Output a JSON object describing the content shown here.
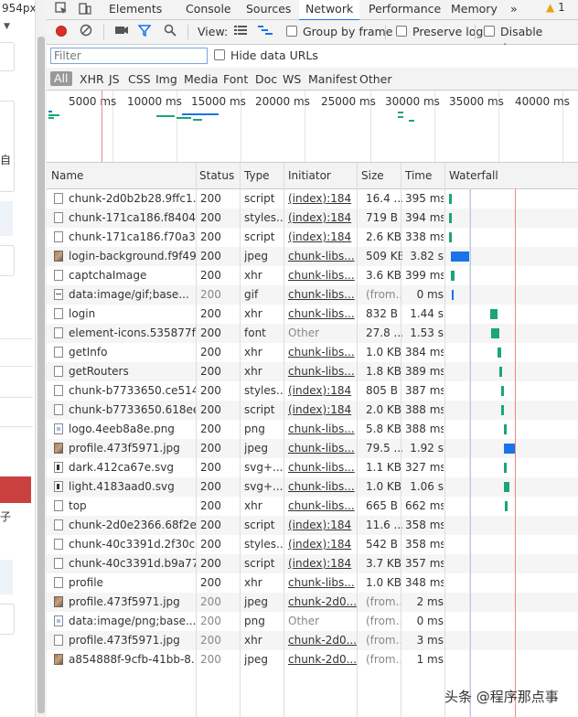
{
  "left": {
    "px_label": "954px",
    "zh_char": "自",
    "zh_char2": "子"
  },
  "tabs": {
    "items": [
      "Elements",
      "Console",
      "Sources",
      "Network",
      "Performance",
      "Memory"
    ],
    "more": "»",
    "warn_count": "1"
  },
  "toolbar": {
    "view_label": "View:",
    "group_by_frame": "Group by frame",
    "preserve_log": "Preserve log",
    "disable_cache": "Disable cache"
  },
  "filter": {
    "placeholder": "Filter",
    "hide_data_urls": "Hide data URLs"
  },
  "types": [
    "All",
    "XHR",
    "JS",
    "CSS",
    "Img",
    "Media",
    "Font",
    "Doc",
    "WS",
    "Manifest",
    "Other"
  ],
  "overview": {
    "labels": [
      "5000 ms",
      "10000 ms",
      "15000 ms",
      "20000 ms",
      "25000 ms",
      "30000 ms",
      "35000 ms",
      "40000 ms"
    ]
  },
  "columns": [
    "Name",
    "Status",
    "Type",
    "Initiator",
    "Size",
    "Time",
    "Waterfall"
  ],
  "rows": [
    {
      "name": "chunk-2d0b2b28.9ffc1...",
      "status": "200",
      "type": "script",
      "initiator": "(index):184",
      "size": "16.4 ...",
      "time": "395 ms",
      "icon": "doc"
    },
    {
      "name": "chunk-171ca186.f8404...",
      "status": "200",
      "type": "styles...",
      "initiator": "(index):184",
      "size": "719 B",
      "time": "394 ms",
      "icon": "doc"
    },
    {
      "name": "chunk-171ca186.f70a3f...",
      "status": "200",
      "type": "script",
      "initiator": "(index):184",
      "size": "2.6 KB",
      "time": "338 ms",
      "icon": "doc"
    },
    {
      "name": "login-background.f9f49...",
      "status": "200",
      "type": "jpeg",
      "initiator": "chunk-libs...",
      "size": "509 KB",
      "time": "3.82 s",
      "icon": "img"
    },
    {
      "name": "captchaImage",
      "status": "200",
      "type": "xhr",
      "initiator": "chunk-libs...",
      "size": "3.6 KB",
      "time": "399 ms",
      "icon": "doc"
    },
    {
      "name": "data:image/gif;base...",
      "status": "200",
      "type": "gif",
      "initiator": "chunk-libs...",
      "size": "(from...",
      "time": "0 ms",
      "icon": "gif"
    },
    {
      "name": "login",
      "status": "200",
      "type": "xhr",
      "initiator": "chunk-libs...",
      "size": "832 B",
      "time": "1.44 s",
      "icon": "doc"
    },
    {
      "name": "element-icons.535877f...",
      "status": "200",
      "type": "font",
      "initiator": "Other",
      "size": "27.8 ...",
      "time": "1.53 s",
      "icon": "doc"
    },
    {
      "name": "getInfo",
      "status": "200",
      "type": "xhr",
      "initiator": "chunk-libs...",
      "size": "1.0 KB",
      "time": "384 ms",
      "icon": "doc"
    },
    {
      "name": "getRouters",
      "status": "200",
      "type": "xhr",
      "initiator": "chunk-libs...",
      "size": "1.8 KB",
      "time": "389 ms",
      "icon": "doc"
    },
    {
      "name": "chunk-b7733650.ce514...",
      "status": "200",
      "type": "styles...",
      "initiator": "(index):184",
      "size": "805 B",
      "time": "387 ms",
      "icon": "doc"
    },
    {
      "name": "chunk-b7733650.618ee...",
      "status": "200",
      "type": "script",
      "initiator": "(index):184",
      "size": "2.0 KB",
      "time": "388 ms",
      "icon": "doc"
    },
    {
      "name": "logo.4eeb8a8e.png",
      "status": "200",
      "type": "png",
      "initiator": "chunk-libs...",
      "size": "5.8 KB",
      "time": "388 ms",
      "icon": "png"
    },
    {
      "name": "profile.473f5971.jpg",
      "status": "200",
      "type": "jpeg",
      "initiator": "chunk-libs...",
      "size": "79.5 ...",
      "time": "1.92 s",
      "icon": "img"
    },
    {
      "name": "dark.412ca67e.svg",
      "status": "200",
      "type": "svg+...",
      "initiator": "chunk-libs...",
      "size": "1.1 KB",
      "time": "327 ms",
      "icon": "svg"
    },
    {
      "name": "light.4183aad0.svg",
      "status": "200",
      "type": "svg+...",
      "initiator": "chunk-libs...",
      "size": "1.0 KB",
      "time": "1.06 s",
      "icon": "svg"
    },
    {
      "name": "top",
      "status": "200",
      "type": "xhr",
      "initiator": "chunk-libs...",
      "size": "665 B",
      "time": "662 ms",
      "icon": "doc"
    },
    {
      "name": "chunk-2d0e2366.68f2e...",
      "status": "200",
      "type": "script",
      "initiator": "(index):184",
      "size": "11.6 ...",
      "time": "358 ms",
      "icon": "doc"
    },
    {
      "name": "chunk-40c3391d.2f30c...",
      "status": "200",
      "type": "styles...",
      "initiator": "(index):184",
      "size": "542 B",
      "time": "358 ms",
      "icon": "doc"
    },
    {
      "name": "chunk-40c3391d.b9a77...",
      "status": "200",
      "type": "script",
      "initiator": "(index):184",
      "size": "3.7 KB",
      "time": "357 ms",
      "icon": "doc"
    },
    {
      "name": "profile",
      "status": "200",
      "type": "xhr",
      "initiator": "chunk-libs...",
      "size": "1.0 KB",
      "time": "348 ms",
      "icon": "doc"
    },
    {
      "name": "profile.473f5971.jpg",
      "status": "200",
      "type": "jpeg",
      "initiator": "chunk-2d0...",
      "size": "(from...",
      "time": "2 ms",
      "icon": "img"
    },
    {
      "name": "data:image/png;base...",
      "status": "200",
      "type": "png",
      "initiator": "Other",
      "size": "(from...",
      "time": "0 ms",
      "icon": "png"
    },
    {
      "name": "profile.473f5971.jpg",
      "status": "200",
      "type": "xhr",
      "initiator": "chunk-2d0...",
      "size": "(from...",
      "time": "3 ms",
      "icon": "doc"
    },
    {
      "name": "a854888f-9cfb-41bb-8...",
      "status": "200",
      "type": "jpeg",
      "initiator": "chunk-2d0...",
      "size": "(from...",
      "time": "1 ms",
      "icon": "img"
    }
  ],
  "watermark": "头条 @程序那点事"
}
